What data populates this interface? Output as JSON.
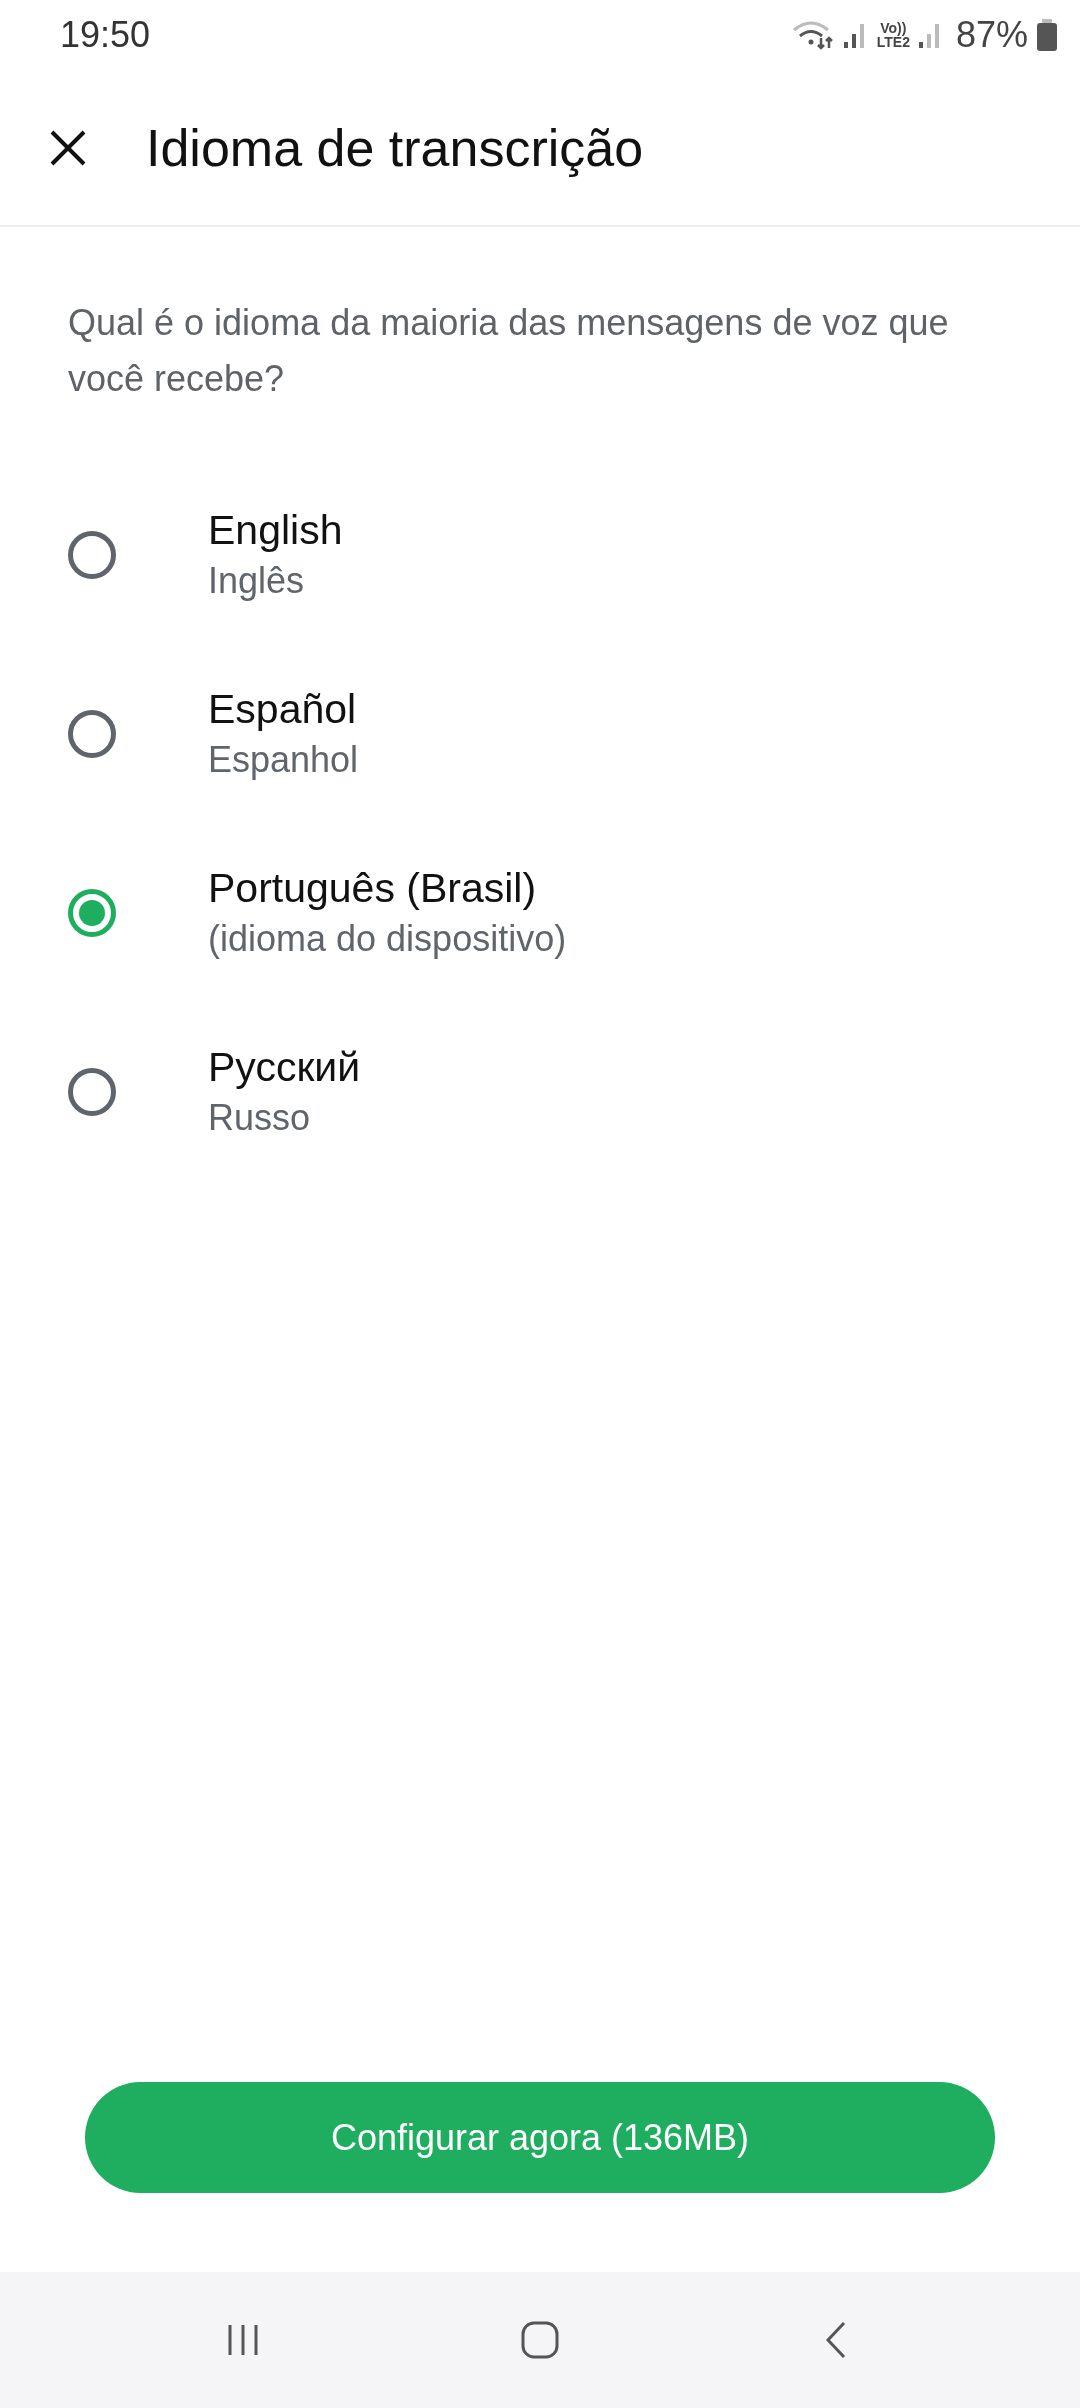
{
  "status_bar": {
    "time": "19:50",
    "volte_top": "Vo))",
    "volte_bottom": "LTE2",
    "battery": "87%"
  },
  "header": {
    "title": "Idioma de transcrição"
  },
  "question": "Qual é o idioma da maioria das mensagens de voz que você recebe?",
  "options": [
    {
      "label": "English",
      "sublabel": "Inglês",
      "selected": false
    },
    {
      "label": "Español",
      "sublabel": "Espanhol",
      "selected": false
    },
    {
      "label": "Português (Brasil)",
      "sublabel": "(idioma do dispositivo)",
      "selected": true
    },
    {
      "label": "Русский",
      "sublabel": "Russo",
      "selected": false
    }
  ],
  "button": {
    "label": "Configurar agora (136MB)"
  }
}
